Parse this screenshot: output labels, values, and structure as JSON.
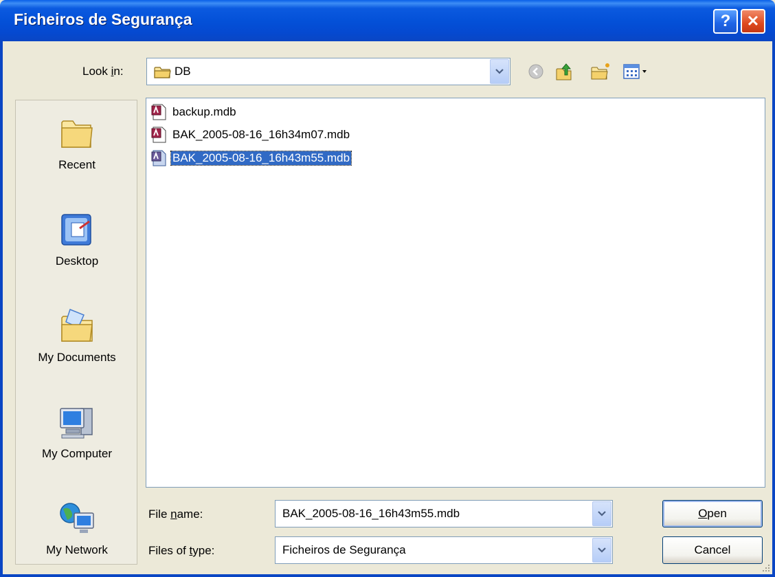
{
  "window": {
    "title": "Ficheiros de Segurança",
    "help_label": "?",
    "close_label": "✕"
  },
  "lookin": {
    "label_pre": "Look ",
    "label_accel": "i",
    "label_post": "n:",
    "value": "DB"
  },
  "toolbar": {
    "icons": [
      "back-icon",
      "up-folder-icon",
      "new-folder-icon",
      "view-menu-icon"
    ]
  },
  "places": [
    {
      "label": "Recent",
      "icon": "recent-folder-icon"
    },
    {
      "label": "Desktop",
      "icon": "desktop-icon"
    },
    {
      "label": "My Documents",
      "icon": "my-documents-icon"
    },
    {
      "label": "My Computer",
      "icon": "my-computer-icon"
    },
    {
      "label": "My Network",
      "icon": "my-network-icon"
    }
  ],
  "files": [
    {
      "name": "backup.mdb",
      "selected": false
    },
    {
      "name": "BAK_2005-08-16_16h34m07.mdb",
      "selected": false
    },
    {
      "name": "BAK_2005-08-16_16h43m55.mdb",
      "selected": true
    }
  ],
  "filename": {
    "label_pre": "File ",
    "label_accel": "n",
    "label_post": "ame:",
    "value": "BAK_2005-08-16_16h43m55.mdb"
  },
  "filetype": {
    "label_pre": "Files of ",
    "label_accel": "t",
    "label_post": "ype:",
    "value": "Ficheiros de Segurança"
  },
  "buttons": {
    "open_accel": "O",
    "open_rest": "pen",
    "cancel": "Cancel"
  },
  "colors": {
    "titlebar": "#0451d8",
    "selection": "#316ac5",
    "dialog_bg": "#ece9d8"
  }
}
